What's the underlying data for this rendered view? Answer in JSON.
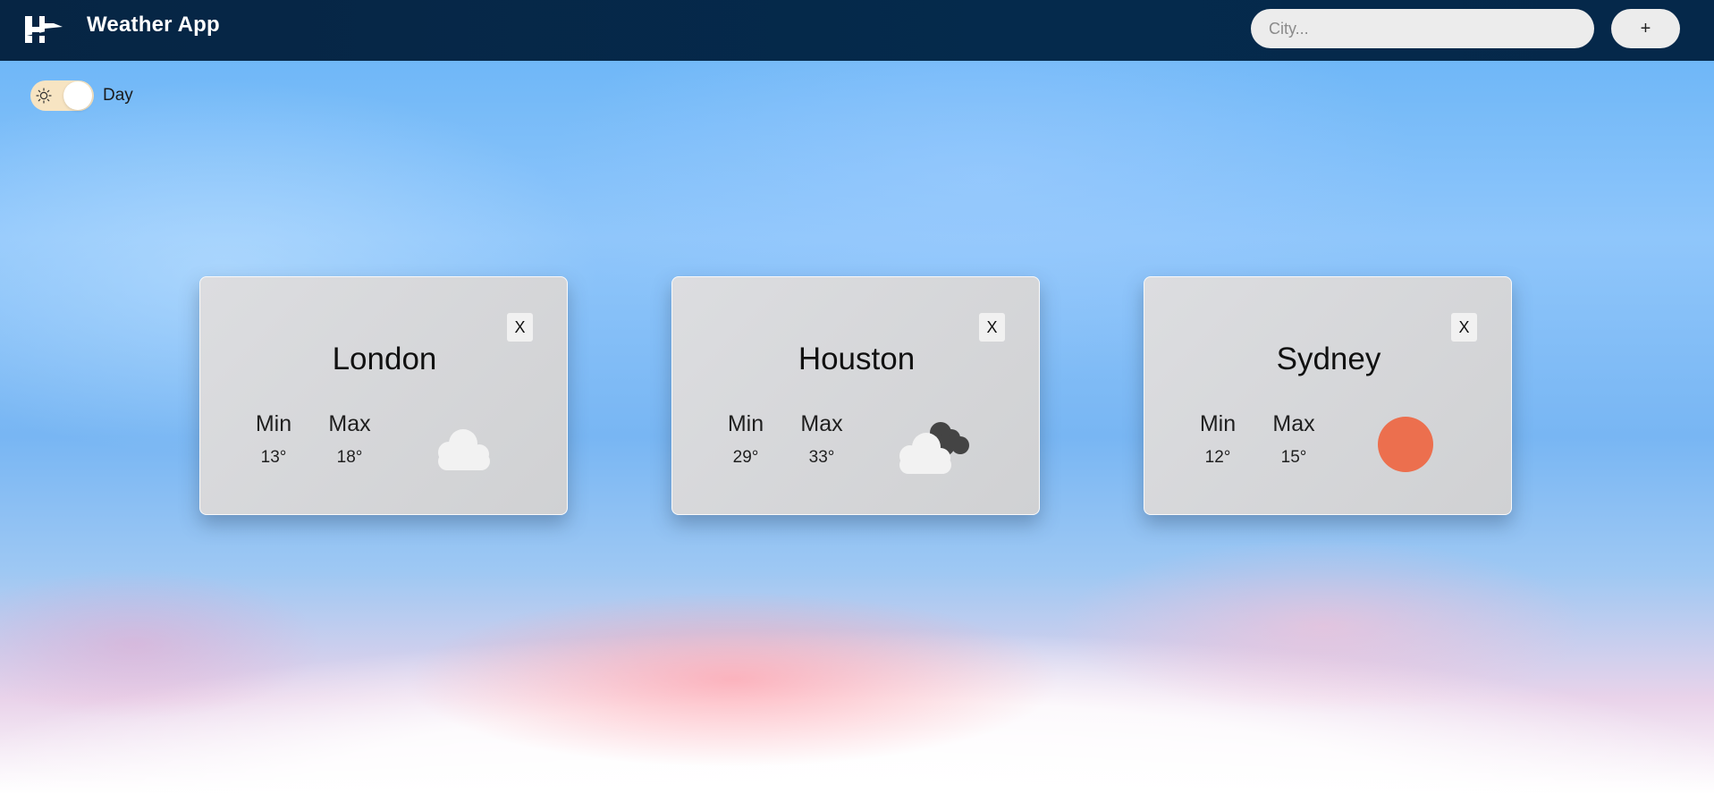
{
  "header": {
    "title": "Weather App",
    "search_placeholder": "City...",
    "add_label": "+"
  },
  "theme_toggle": {
    "label": "Day",
    "state": "day",
    "track_color": "#f7e4c2"
  },
  "cards": [
    {
      "city": "London",
      "min_label": "Min",
      "max_label": "Max",
      "min": "13°",
      "max": "18°",
      "icon": "cloud-icon",
      "close_label": "X"
    },
    {
      "city": "Houston",
      "min_label": "Min",
      "max_label": "Max",
      "min": "29°",
      "max": "33°",
      "icon": "partly-cloudy-icon",
      "close_label": "X"
    },
    {
      "city": "Sydney",
      "min_label": "Min",
      "max_label": "Max",
      "min": "12°",
      "max": "15°",
      "icon": "sun-icon",
      "close_label": "X"
    }
  ],
  "colors": {
    "header_bg": "#062544",
    "sun": "#ec6f4e",
    "cloud_light": "#f2f2f2",
    "cloud_dark": "#444444"
  }
}
